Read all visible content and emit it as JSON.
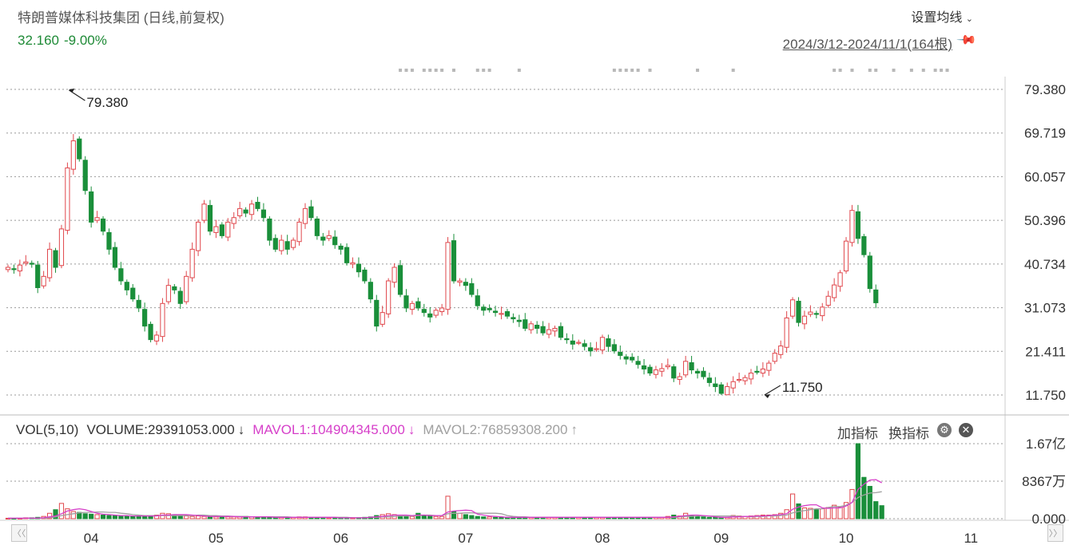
{
  "header": {
    "title": "特朗普媒体科技集团 (日线,前复权)",
    "price": "32.160",
    "change_pct": "-9.00%",
    "ma_setting_label": "设置均线",
    "date_range": "2024/3/12-2024/11/1(164根)"
  },
  "volume_panel": {
    "label": "VOL(5,10)",
    "volume_text": "VOLUME:29391053.000",
    "volume_arrow": "↓",
    "mavol1_text": "MAVOL1:104904345.000",
    "mavol1_arrow": "↓",
    "mavol2_text": "MAVOL2:76859308.200",
    "mavol2_arrow": "↑",
    "add_indicator_label": "加指标",
    "switch_indicator_label": "换指标"
  },
  "colors": {
    "up": "#e0474c",
    "down": "#1a8f3a",
    "mavol1": "#d63fc9",
    "mavol2": "#a0a0a0",
    "grid": "#999999",
    "quote": "#1e8a36"
  },
  "chart_data": {
    "type": "candlestick",
    "price_axis_ticks": [
      "79.380",
      "69.719",
      "60.057",
      "50.396",
      "40.734",
      "31.073",
      "21.411",
      "11.750"
    ],
    "volume_axis_ticks": [
      "1.67亿",
      "8367万",
      "0.000"
    ],
    "month_labels": [
      "04",
      "05",
      "06",
      "07",
      "08",
      "09",
      "10",
      "11"
    ],
    "month_positions": [
      14,
      35,
      56,
      77,
      100,
      120,
      141,
      162
    ],
    "ylim": [
      11.75,
      79.38
    ],
    "volume_ylim_yi": [
      0,
      1.67
    ],
    "annotations": [
      {
        "text": "79.380",
        "index": 10,
        "value": 79.38,
        "kind": "max"
      },
      {
        "text": "11.750",
        "index": 127,
        "value": 11.75,
        "kind": "min"
      }
    ],
    "closes": [
      40,
      39.5,
      40.5,
      41.2,
      40.8,
      35.5,
      38,
      44,
      40,
      48.5,
      62,
      68,
      64,
      57,
      50,
      51,
      48,
      44,
      40,
      37,
      35,
      33,
      31,
      27,
      24,
      25,
      32,
      36,
      35,
      32,
      38,
      44,
      50,
      54,
      48,
      49,
      47,
      50,
      51,
      53,
      52,
      54,
      53,
      51,
      46,
      44,
      46,
      44,
      46,
      50,
      53,
      51,
      47,
      46,
      47,
      45,
      44,
      41,
      41,
      39,
      37,
      33,
      27,
      30,
      37,
      40,
      34,
      31,
      32,
      31,
      30,
      29,
      30.5,
      31,
      45.5,
      37,
      37,
      36,
      34,
      31.5,
      30.5,
      30.6,
      30,
      29.8,
      29.2,
      28.6,
      28,
      26.5,
      27.5,
      26.5,
      25.5,
      26.2,
      26.5,
      24.5,
      24,
      23,
      23.4,
      22.5,
      21.5,
      22,
      24.5,
      22.5,
      21.5,
      20.5,
      19.7,
      19.5,
      18.5,
      17.5,
      16.6,
      17.3,
      17.6,
      18.3,
      15.5,
      15.8,
      19.2,
      17.3,
      16.6,
      15.8,
      14.5,
      13.6,
      12.1,
      13.6,
      14.7,
      15.2,
      15.6,
      16.6,
      16.9,
      17.5,
      18.8,
      21,
      22.6,
      28.8,
      32.8,
      27.8,
      29.2,
      30.1,
      29.6,
      31.2,
      33.6,
      36.1,
      38.8,
      45.8,
      52.6,
      46.4,
      42.8,
      35.3,
      32.16
    ],
    "volume_yi": [
      0.01,
      0.01,
      0.01,
      0.02,
      0.02,
      0.03,
      0.05,
      0.12,
      0.2,
      0.34,
      0.22,
      0.16,
      0.14,
      0.11,
      0.1,
      0.09,
      0.08,
      0.07,
      0.07,
      0.06,
      0.06,
      0.05,
      0.05,
      0.06,
      0.07,
      0.08,
      0.12,
      0.11,
      0.09,
      0.07,
      0.06,
      0.05,
      0.06,
      0.05,
      0.05,
      0.04,
      0.05,
      0.04,
      0.04,
      0.04,
      0.05,
      0.04,
      0.04,
      0.03,
      0.03,
      0.03,
      0.03,
      0.03,
      0.03,
      0.04,
      0.04,
      0.03,
      0.03,
      0.02,
      0.02,
      0.02,
      0.02,
      0.02,
      0.02,
      0.02,
      0.03,
      0.04,
      0.07,
      0.09,
      0.11,
      0.09,
      0.06,
      0.05,
      0.05,
      0.12,
      0.08,
      0.06,
      0.05,
      0.05,
      0.5,
      0.16,
      0.12,
      0.09,
      0.07,
      0.05,
      0.04,
      0.04,
      0.03,
      0.03,
      0.03,
      0.03,
      0.03,
      0.03,
      0.03,
      0.03,
      0.03,
      0.03,
      0.03,
      0.03,
      0.03,
      0.03,
      0.03,
      0.03,
      0.03,
      0.03,
      0.03,
      0.03,
      0.03,
      0.03,
      0.03,
      0.03,
      0.03,
      0.03,
      0.03,
      0.03,
      0.03,
      0.05,
      0.08,
      0.06,
      0.12,
      0.07,
      0.05,
      0.04,
      0.03,
      0.03,
      0.03,
      0.03,
      0.07,
      0.06,
      0.05,
      0.06,
      0.07,
      0.08,
      0.08,
      0.09,
      0.12,
      0.2,
      0.55,
      0.33,
      0.24,
      0.23,
      0.2,
      0.22,
      0.25,
      0.3,
      0.25,
      0.36,
      0.65,
      1.67,
      0.92,
      0.72,
      0.38,
      0.29
    ],
    "mavol1_yi": [
      0.01,
      0.01,
      0.01,
      0.01,
      0.01,
      0.01,
      0.02,
      0.04,
      0.06,
      0.11,
      0.17,
      0.2,
      0.22,
      0.2,
      0.16,
      0.12,
      0.1,
      0.09,
      0.08,
      0.07,
      0.07,
      0.06,
      0.06,
      0.06,
      0.06,
      0.06,
      0.08,
      0.08,
      0.09,
      0.09,
      0.09,
      0.08,
      0.07,
      0.06,
      0.05,
      0.05,
      0.05,
      0.05,
      0.05,
      0.04,
      0.04,
      0.04,
      0.04,
      0.04,
      0.04,
      0.03,
      0.03,
      0.03,
      0.03,
      0.03,
      0.03,
      0.03,
      0.03,
      0.03,
      0.03,
      0.03,
      0.02,
      0.02,
      0.02,
      0.02,
      0.02,
      0.03,
      0.04,
      0.05,
      0.07,
      0.08,
      0.08,
      0.08,
      0.07,
      0.08,
      0.08,
      0.07,
      0.07,
      0.07,
      0.15,
      0.17,
      0.18,
      0.19,
      0.18,
      0.1,
      0.08,
      0.06,
      0.05,
      0.04,
      0.03,
      0.03,
      0.03,
      0.03,
      0.03,
      0.03,
      0.03,
      0.03,
      0.03,
      0.03,
      0.03,
      0.03,
      0.03,
      0.03,
      0.03,
      0.03,
      0.03,
      0.03,
      0.03,
      0.03,
      0.03,
      0.03,
      0.03,
      0.03,
      0.03,
      0.03,
      0.03,
      0.03,
      0.04,
      0.05,
      0.07,
      0.08,
      0.08,
      0.07,
      0.06,
      0.04,
      0.03,
      0.03,
      0.04,
      0.04,
      0.05,
      0.05,
      0.06,
      0.06,
      0.07,
      0.08,
      0.09,
      0.11,
      0.21,
      0.26,
      0.29,
      0.31,
      0.31,
      0.24,
      0.23,
      0.24,
      0.24,
      0.28,
      0.36,
      0.65,
      0.77,
      0.86,
      0.87,
      0.8
    ],
    "mavol2_yi": [
      0.01,
      0.01,
      0.01,
      0.01,
      0.01,
      0.01,
      0.01,
      0.02,
      0.04,
      0.07,
      0.09,
      0.11,
      0.13,
      0.14,
      0.14,
      0.15,
      0.15,
      0.14,
      0.14,
      0.12,
      0.11,
      0.09,
      0.08,
      0.07,
      0.07,
      0.07,
      0.07,
      0.07,
      0.07,
      0.07,
      0.07,
      0.07,
      0.08,
      0.08,
      0.07,
      0.07,
      0.06,
      0.06,
      0.05,
      0.05,
      0.05,
      0.04,
      0.04,
      0.04,
      0.04,
      0.04,
      0.04,
      0.04,
      0.03,
      0.03,
      0.03,
      0.03,
      0.03,
      0.03,
      0.03,
      0.03,
      0.03,
      0.03,
      0.02,
      0.02,
      0.02,
      0.03,
      0.03,
      0.04,
      0.04,
      0.05,
      0.06,
      0.06,
      0.06,
      0.07,
      0.08,
      0.08,
      0.07,
      0.07,
      0.11,
      0.12,
      0.12,
      0.13,
      0.13,
      0.12,
      0.12,
      0.12,
      0.12,
      0.11,
      0.07,
      0.05,
      0.04,
      0.04,
      0.03,
      0.03,
      0.03,
      0.03,
      0.03,
      0.03,
      0.03,
      0.03,
      0.03,
      0.03,
      0.03,
      0.03,
      0.03,
      0.03,
      0.03,
      0.03,
      0.03,
      0.03,
      0.03,
      0.03,
      0.03,
      0.03,
      0.03,
      0.03,
      0.03,
      0.04,
      0.05,
      0.05,
      0.06,
      0.06,
      0.06,
      0.06,
      0.06,
      0.06,
      0.06,
      0.05,
      0.05,
      0.04,
      0.05,
      0.05,
      0.06,
      0.06,
      0.07,
      0.08,
      0.13,
      0.16,
      0.18,
      0.2,
      0.22,
      0.22,
      0.25,
      0.27,
      0.27,
      0.3,
      0.36,
      0.47,
      0.53,
      0.57,
      0.58,
      0.6
    ]
  }
}
